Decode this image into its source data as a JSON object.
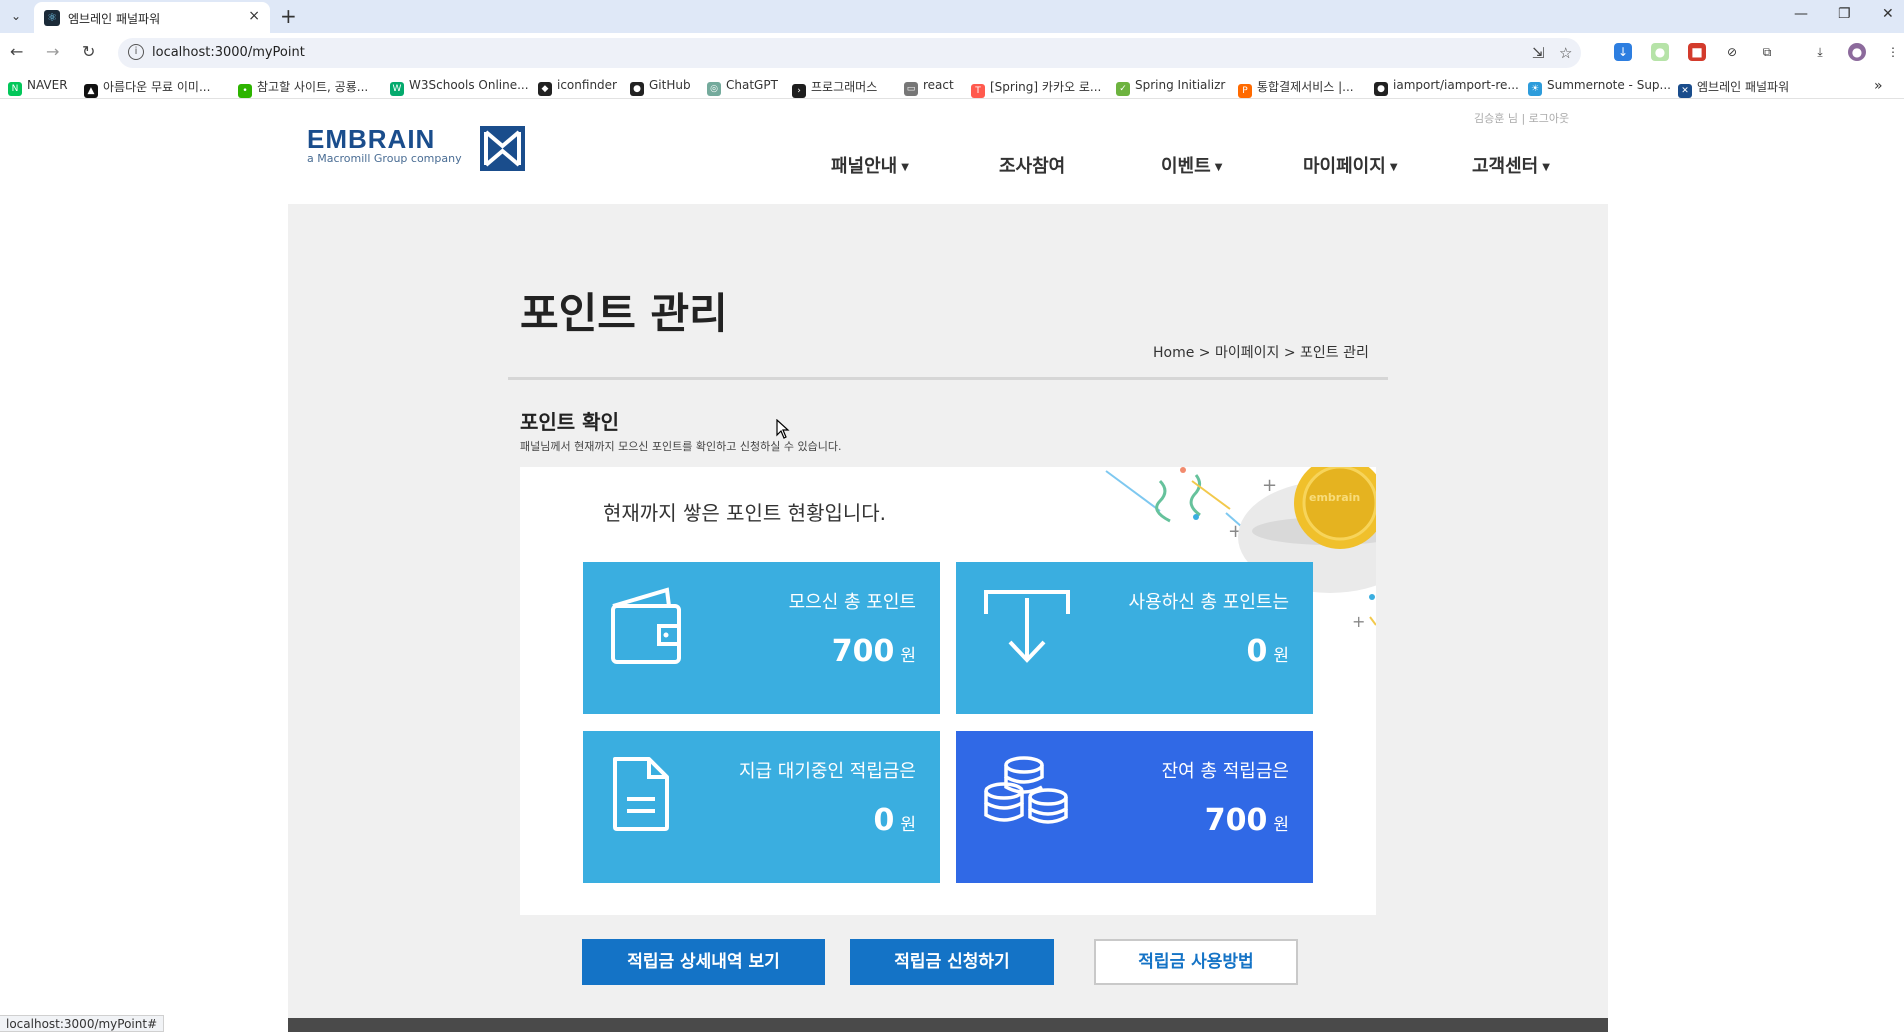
{
  "browser": {
    "tab_title": "엠브레인 패널파워",
    "tab_close": "×",
    "new_tab": "+",
    "url": "localhost:3000/myPoint",
    "window": {
      "minimize": "—",
      "restore": "❐",
      "close": "✕"
    },
    "status_url": "localhost:3000/myPoint#"
  },
  "bookmarks": [
    {
      "label": "NAVER",
      "color": "#03c75a",
      "icon": "N"
    },
    {
      "label": "아름다운 무료 이미...",
      "color": "#111111",
      "icon": "▲"
    },
    {
      "label": "참고할 사이트, 공룡...",
      "color": "#2db400",
      "icon": "•"
    },
    {
      "label": "W3Schools Online...",
      "color": "#04aa6d",
      "icon": "W"
    },
    {
      "label": "iconfinder",
      "color": "#222222",
      "icon": "◆"
    },
    {
      "label": "GitHub",
      "color": "#222222",
      "icon": "●"
    },
    {
      "label": "ChatGPT",
      "color": "#74aa9c",
      "icon": "◎"
    },
    {
      "label": "프로그래머스",
      "color": "#1e1e1e",
      "icon": "›"
    },
    {
      "label": "react",
      "color": "#777777",
      "icon": "▭"
    },
    {
      "label": "[Spring] 카카오 로...",
      "color": "#ff5a4e",
      "icon": "T"
    },
    {
      "label": "Spring Initializr",
      "color": "#6db33f",
      "icon": "✓"
    },
    {
      "label": "통합결제서비스 |...",
      "color": "#ff6a00",
      "icon": "P"
    },
    {
      "label": "iamport/iamport-re...",
      "color": "#222222",
      "icon": "●"
    },
    {
      "label": "Summernote - Sup...",
      "color": "#2d9cdb",
      "icon": "☀"
    },
    {
      "label": "엠브레인 패널파워",
      "color": "#1a4d8c",
      "icon": "✕"
    }
  ],
  "site": {
    "logo_text": "EMBRAIN",
    "logo_sub": "a Macromill Group company",
    "top_links": "김승훈 님 | 로그아웃",
    "nav": [
      {
        "label": "패널안내",
        "dropdown": true
      },
      {
        "label": "조사참여",
        "dropdown": false
      },
      {
        "label": "이벤트",
        "dropdown": true
      },
      {
        "label": "마이페이지",
        "dropdown": true
      },
      {
        "label": "고객센터",
        "dropdown": true
      }
    ]
  },
  "page": {
    "title": "포인트 관리",
    "breadcrumb": "Home > 마이페이지 > 포인트 관리",
    "section_title": "포인트 확인",
    "section_desc": "패널님께서 현재까지 모으신 포인트를 확인하고 신청하실 수 있습니다.",
    "panel_lead": "현재까지 쌓은 포인트 현황입니다.",
    "coin_text": "embrain",
    "cards": [
      {
        "label": "모으신 총 포인트",
        "value": "700",
        "unit": "원",
        "icon": "wallet-icon"
      },
      {
        "label": "사용하신 총 포인트는",
        "value": "0",
        "unit": "원",
        "icon": "download-icon"
      },
      {
        "label": "지급 대기중인 적립금은",
        "value": "0",
        "unit": "원",
        "icon": "document-icon"
      },
      {
        "label": "잔여 총 적립금은",
        "value": "700",
        "unit": "원",
        "icon": "coins-icon"
      }
    ],
    "buttons": {
      "history": "적립금 상세내역 보기",
      "apply": "적립금 신청하기",
      "guide": "적립금 사용방법"
    }
  },
  "colors": {
    "card_light": "#3aaee0",
    "card_dark": "#3069e6",
    "button_primary": "#1473c6",
    "brand": "#1a4d8c"
  }
}
